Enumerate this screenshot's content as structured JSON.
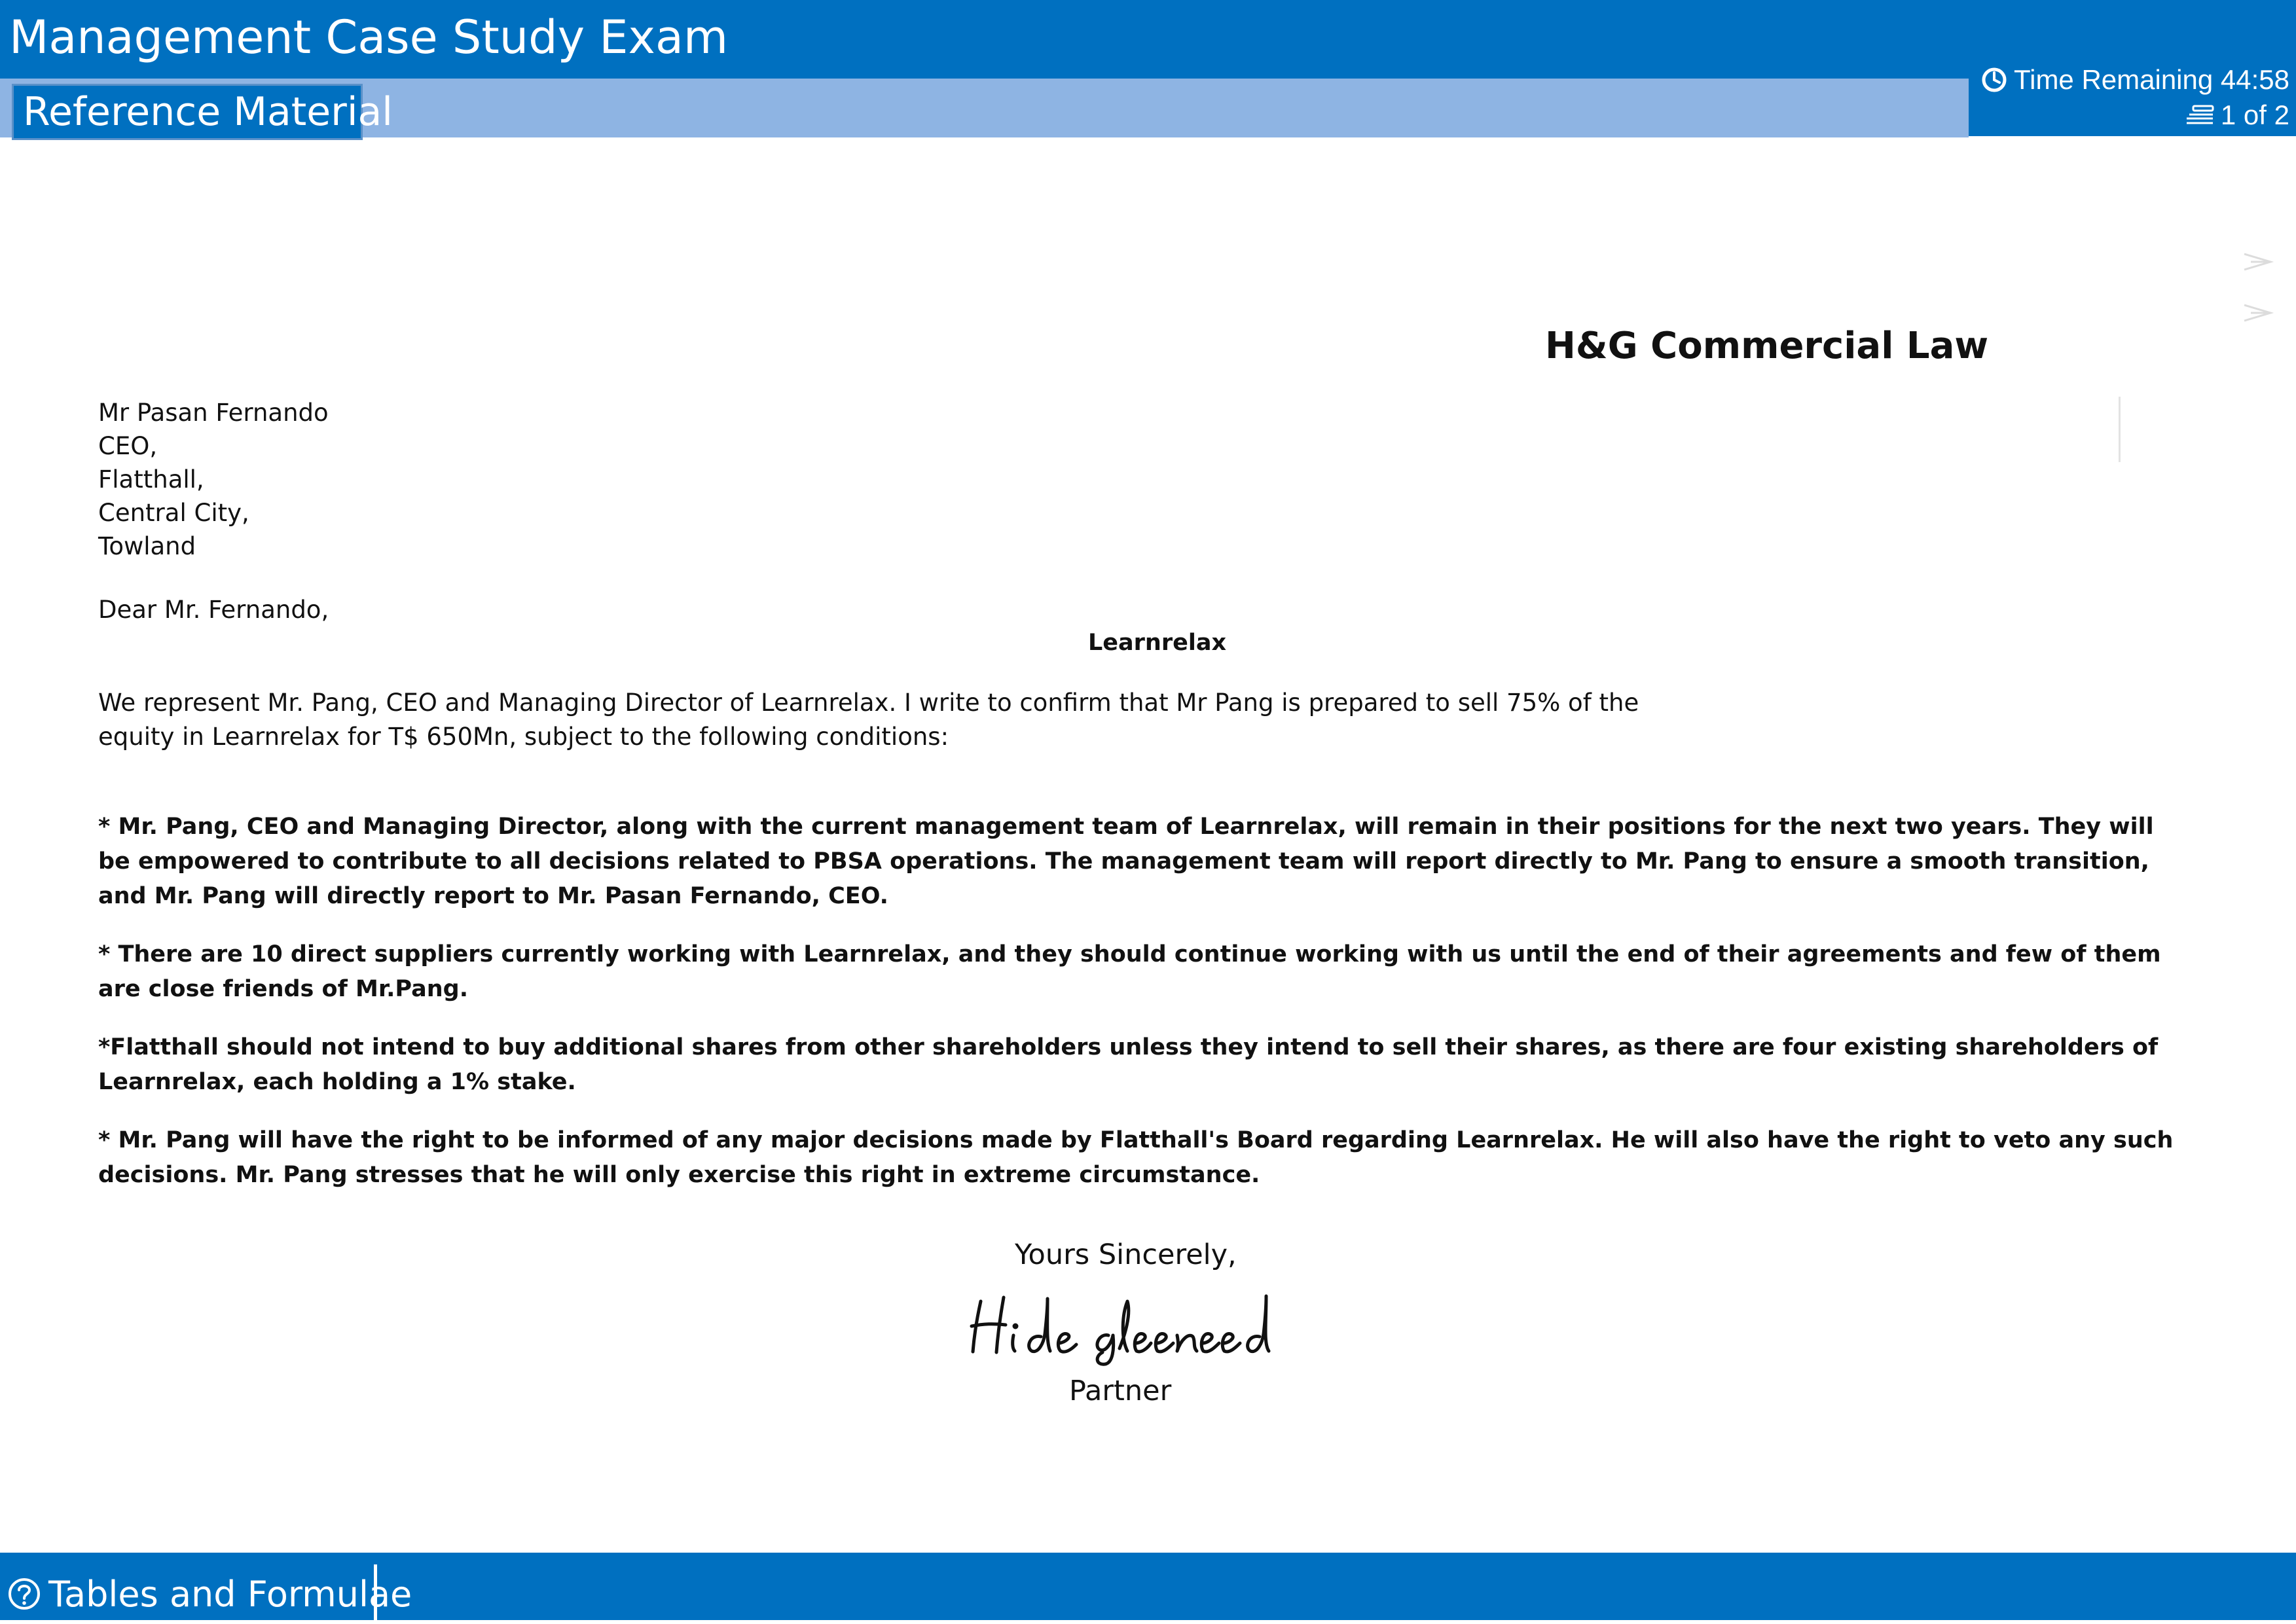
{
  "header": {
    "title": "Management Case Study Exam",
    "tab_label": "Reference Material",
    "timer_text": "Time Remaining 44:58",
    "page_indicator": "1 of 2",
    "timer_icon": "clock-icon",
    "page_icon": "stacked-pages-icon"
  },
  "letter": {
    "firm_name": "H&G Commercial Law",
    "address": [
      "Mr Pasan Fernando",
      "CEO,",
      "Flatthall,",
      "Central City,",
      "Towland"
    ],
    "salutation": "Dear Mr. Fernando,",
    "subject": "Learnrelax",
    "intro": "We represent Mr. Pang, CEO and Managing Director of Learnrelax. I write to confirm that Mr Pang is prepared to sell 75% of the equity in Learnrelax for T$ 650Mn, subject to the following conditions:",
    "conditions": [
      "* Mr. Pang, CEO and Managing Director, along with the current management team of Learnrelax, will remain in their positions for the next two years. They will be empowered to contribute to all decisions related to PBSA operations. The management team will report directly to Mr. Pang to ensure a smooth transition, and Mr. Pang will directly report to Mr. Pasan Fernando, CEO.",
      "* There are 10 direct suppliers currently working with Learnrelax, and they should continue working with us until the end of their agreements and few of them are close friends of Mr.Pang.",
      "*Flatthall should not intend to buy additional shares from other shareholders unless they intend to sell their shares, as there are four existing shareholders of Learnrelax, each holding a 1% stake.",
      "* Mr. Pang will have the right to be informed of any major decisions made by Flatthall's Board regarding Learnrelax. He will also have the right to veto any such decisions. Mr. Pang stresses that he will only exercise this right in extreme circumstance."
    ],
    "closing": "Yours Sincerely,",
    "signature_text": "Hide gleeneed",
    "signer_title": "Partner"
  },
  "footer": {
    "tables_label": "Tables and Formulae",
    "tables_icon": "help-circle-icon"
  },
  "colors": {
    "bar_blue": "#0070c0",
    "subbar_light_blue": "#8eb4e3",
    "tab_border": "#5a91c9",
    "text": "#111111",
    "white": "#ffffff"
  }
}
